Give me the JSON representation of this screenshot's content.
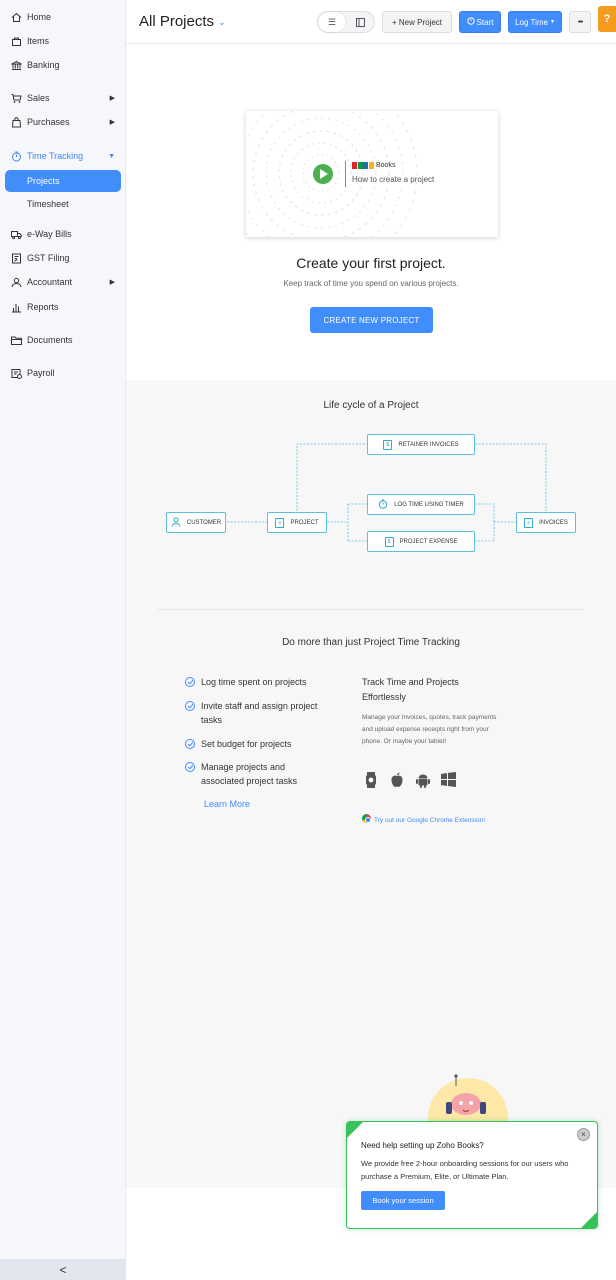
{
  "sidebar": {
    "items": [
      {
        "label": "Home",
        "icon": "home-icon"
      },
      {
        "label": "Items",
        "icon": "bag-icon"
      },
      {
        "label": "Banking",
        "icon": "bank-icon"
      },
      {
        "label": "Sales",
        "icon": "cart-icon"
      },
      {
        "label": "Purchases",
        "icon": "shopping-bag-icon"
      },
      {
        "label": "Time Tracking",
        "icon": "stopwatch-icon"
      },
      {
        "label": "e-Way Bills",
        "icon": "truck-icon"
      },
      {
        "label": "GST Filing",
        "icon": "gst-icon"
      },
      {
        "label": "Accountant",
        "icon": "person-icon"
      },
      {
        "label": "Reports",
        "icon": "bar-chart-icon"
      },
      {
        "label": "Documents",
        "icon": "folder-icon"
      },
      {
        "label": "Payroll",
        "icon": "payroll-icon"
      }
    ],
    "subitems": [
      {
        "label": "Projects",
        "active": true
      },
      {
        "label": "Timesheet",
        "active": false
      }
    ],
    "collapse_glyph": "<"
  },
  "header": {
    "title": "All Projects",
    "new_project": "+ New Project",
    "start": "Start",
    "log_time": "Log Time",
    "more": "•••",
    "help": "?"
  },
  "hero": {
    "video_brand": "Books",
    "video_subtitle": "How to create a project",
    "title": "Create your first project.",
    "subtitle": "Keep track of time you spend on various projects.",
    "cta": "CREATE NEW PROJECT"
  },
  "lifecycle": {
    "title": "Life cycle of a Project",
    "nodes": {
      "customer": "CUSTOMER",
      "project": "PROJECT",
      "retainer": "RETAINER INVOICES",
      "log_time": "LOG TIME USING TIMER",
      "expense": "PROJECT EXPENSE",
      "invoices": "INVOICES"
    }
  },
  "domore": {
    "title": "Do more than just Project Time Tracking",
    "features": [
      "Log time spent on projects",
      "Invite staff and assign project tasks",
      "Set budget for projects",
      "Manage projects and associated project tasks"
    ],
    "learn_more": "Learn More",
    "track_title": "Track Time and Projects Effortlessly",
    "track_desc": "Manage your Invoices, quotes, track payments and upload expense receipts right from your phone. Or maybe your tablet!",
    "platforms": [
      "watch-icon",
      "apple-icon",
      "android-icon",
      "windows-icon"
    ],
    "chrome_link": "Try out our Google Chrome Extension!"
  },
  "popup": {
    "question": "Need help setting up Zoho Books?",
    "message": "We provide free 2-hour onboarding sessions for our users who purchase a Premium, Elite, or Ultimate Plan.",
    "book": "Book your session",
    "close": "×"
  },
  "colors": {
    "accent": "#408dfb",
    "help_tab": "#f59b1d",
    "popup_border": "#3dbd5c",
    "lifecycle_border": "#5cbfe0"
  }
}
